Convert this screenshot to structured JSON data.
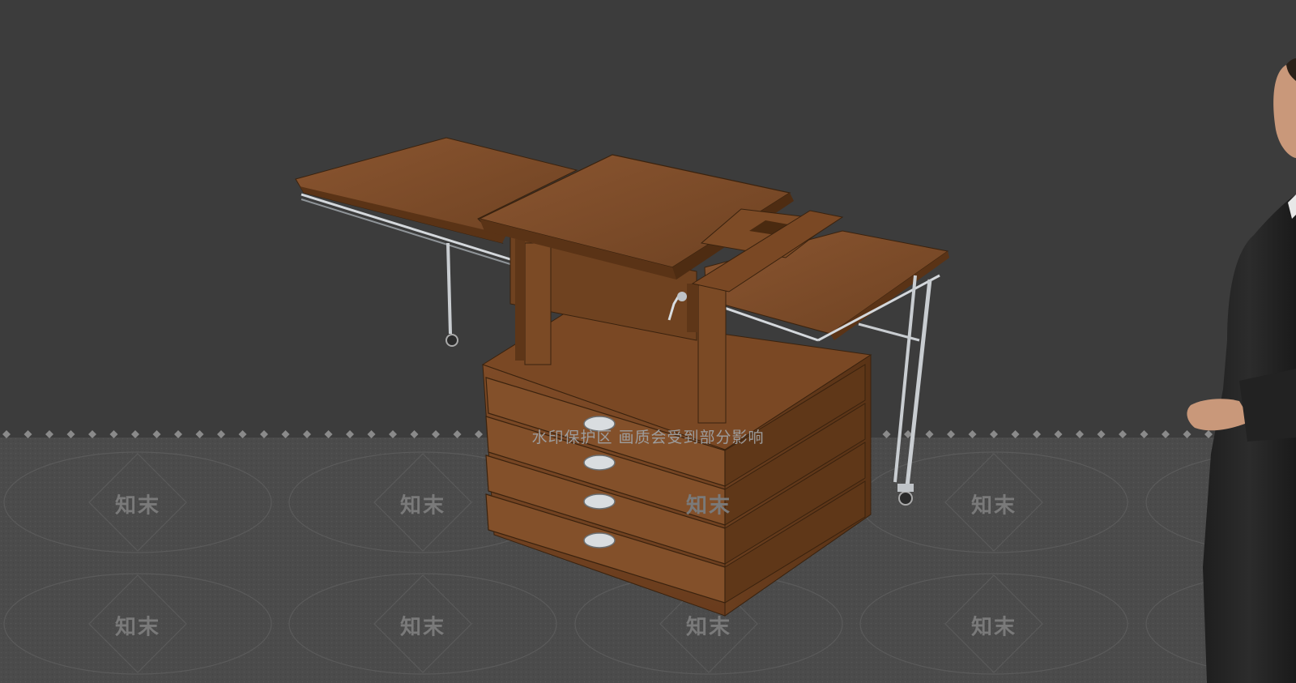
{
  "watermark": {
    "banner_text": "水印保护区  画质会受到部分影响",
    "logo_text": "知末"
  },
  "colors": {
    "background": "#3c3c3c",
    "floor": "#4a4a4a",
    "wood": "#7a4a26",
    "wood_dark": "#5a3418",
    "wood_light": "#8e5a30",
    "metal": "#c8ccd0"
  }
}
